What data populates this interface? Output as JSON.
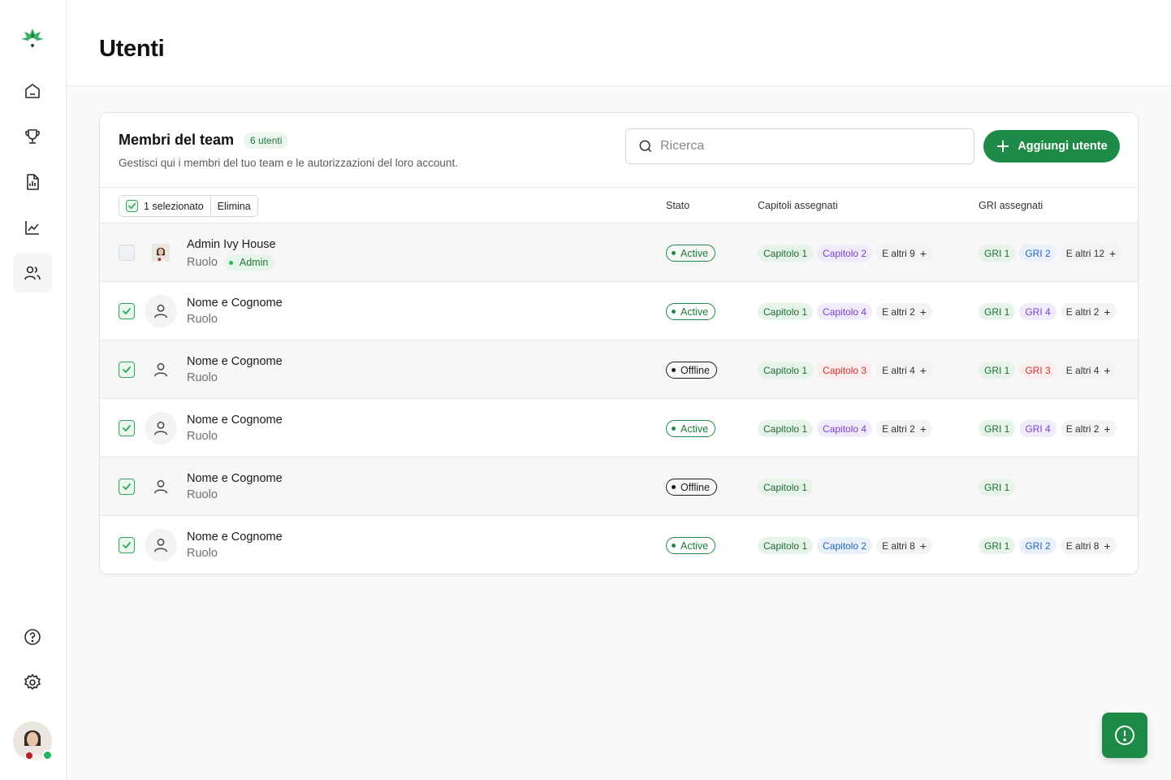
{
  "page": {
    "title": "Utenti"
  },
  "sidebar": {
    "logo": "leaf-logo-icon",
    "items": [
      {
        "name": "home",
        "icon": "home-icon",
        "active": false
      },
      {
        "name": "trophy",
        "icon": "trophy-icon",
        "active": false
      },
      {
        "name": "report",
        "icon": "report-icon",
        "active": false
      },
      {
        "name": "analytics",
        "icon": "chart-icon",
        "active": false
      },
      {
        "name": "users",
        "icon": "users-icon",
        "active": true
      }
    ],
    "bottom": [
      {
        "name": "help",
        "icon": "help-icon"
      },
      {
        "name": "settings",
        "icon": "gear-icon"
      }
    ],
    "online_color": "#27b55c"
  },
  "team": {
    "title": "Membri del team",
    "count": "6 utenti",
    "subtitle": "Gestisci qui i membri del tuo team e le autorizzazioni del loro account.",
    "search_placeholder": "Ricerca",
    "add_label": "Aggiungi utente",
    "accent": "#1e8a47"
  },
  "table": {
    "selected_label": "1 selezionato",
    "delete_label": "Elimina",
    "columns": {
      "stato": "Stato",
      "capitoli": "Capitoli assegnati",
      "gri": "GRI assegnati"
    },
    "rows": [
      {
        "name": "Admin Ivy House",
        "role": "Ruolo",
        "role_badge": "Admin",
        "checked": false,
        "photo": true,
        "status": "Active",
        "capitoli": [
          {
            "label": "Capitolo 1",
            "color": "green"
          },
          {
            "label": "Capitolo 2",
            "color": "purple"
          },
          {
            "label": "E altri 9",
            "color": "more"
          }
        ],
        "gri": [
          {
            "label": "GRI 1",
            "color": "green"
          },
          {
            "label": "GRI 2",
            "color": "blue"
          },
          {
            "label": "E altri 12",
            "color": "more"
          }
        ]
      },
      {
        "name": "Nome e Cognome",
        "role": "Ruolo",
        "checked": true,
        "status": "Active",
        "capitoli": [
          {
            "label": "Capitolo 1",
            "color": "green"
          },
          {
            "label": "Capitolo 4",
            "color": "purple"
          },
          {
            "label": "E altri 2",
            "color": "more"
          }
        ],
        "gri": [
          {
            "label": "GRI 1",
            "color": "green"
          },
          {
            "label": "GRI 4",
            "color": "purple"
          },
          {
            "label": "E altri 2",
            "color": "more"
          }
        ]
      },
      {
        "name": "Nome e Cognome",
        "role": "Ruolo",
        "checked": true,
        "status": "Offline",
        "capitoli": [
          {
            "label": "Capitolo 1",
            "color": "green"
          },
          {
            "label": "Capitolo 3",
            "color": "red"
          },
          {
            "label": "E altri 4",
            "color": "more"
          }
        ],
        "gri": [
          {
            "label": "GRI 1",
            "color": "green"
          },
          {
            "label": "GRI 3",
            "color": "red"
          },
          {
            "label": "E altri 4",
            "color": "more"
          }
        ]
      },
      {
        "name": "Nome e Cognome",
        "role": "Ruolo",
        "checked": true,
        "status": "Active",
        "capitoli": [
          {
            "label": "Capitolo 1",
            "color": "green"
          },
          {
            "label": "Capitolo 4",
            "color": "purple"
          },
          {
            "label": "E altri 2",
            "color": "more"
          }
        ],
        "gri": [
          {
            "label": "GRI 1",
            "color": "green"
          },
          {
            "label": "GRI 4",
            "color": "purple"
          },
          {
            "label": "E altri 2",
            "color": "more"
          }
        ]
      },
      {
        "name": "Nome e Cognome",
        "role": "Ruolo",
        "checked": true,
        "status": "Offline",
        "capitoli": [
          {
            "label": "Capitolo 1",
            "color": "green"
          }
        ],
        "gri": [
          {
            "label": "GRI 1",
            "color": "green"
          }
        ]
      },
      {
        "name": "Nome e Cognome",
        "role": "Ruolo",
        "checked": true,
        "status": "Active",
        "capitoli": [
          {
            "label": "Capitolo 1",
            "color": "green"
          },
          {
            "label": "Capitolo 2",
            "color": "blue"
          },
          {
            "label": "E altri 8",
            "color": "more"
          }
        ],
        "gri": [
          {
            "label": "GRI 1",
            "color": "green"
          },
          {
            "label": "GRI 2",
            "color": "blue"
          },
          {
            "label": "E altri 8",
            "color": "more"
          }
        ]
      }
    ]
  },
  "fab": {
    "icon": "alert-icon"
  }
}
